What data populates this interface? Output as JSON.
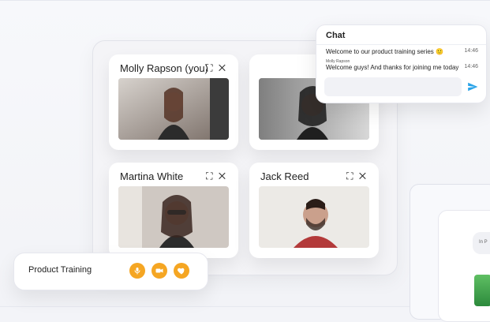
{
  "participants": [
    {
      "name": "Molly Rapson (you)",
      "controls": "⛶ ✕"
    },
    {
      "name": "",
      "controls": ""
    },
    {
      "name": "Martina White",
      "controls": "⛶ ✕"
    },
    {
      "name": "Jack Reed",
      "controls": "⛶ ✕"
    }
  ],
  "chat": {
    "title": "Chat",
    "messages": [
      {
        "sender": "",
        "text": "Welcome to our product training series 🙂",
        "time": "14:46"
      },
      {
        "sender": "Molly Rapson",
        "text": "Welcome guys! And thanks for joining me today",
        "time": "14:46"
      }
    ],
    "send_icon": "send-arrow-icon"
  },
  "bar": {
    "label": "Product Training",
    "buttons": [
      "microphone-icon",
      "camera-icon",
      "heart-icon"
    ]
  },
  "side_preview": {
    "pill_text": "In P"
  },
  "colors": {
    "accent": "#f5a623",
    "send": "#2aa3e8"
  }
}
